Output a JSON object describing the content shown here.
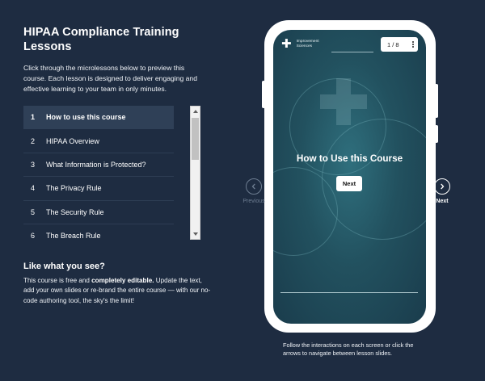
{
  "page": {
    "title": "HIPAA Compliance Training Lessons",
    "intro": "Click through the microlessons below to preview this course. Each lesson is designed to deliver engaging and effective learning to your team in only minutes."
  },
  "lessons": [
    {
      "num": "1",
      "label": "How to use this course",
      "active": true
    },
    {
      "num": "2",
      "label": "HIPAA Overview",
      "active": false
    },
    {
      "num": "3",
      "label": "What Information is Protected?",
      "active": false
    },
    {
      "num": "4",
      "label": "The Privacy Rule",
      "active": false
    },
    {
      "num": "5",
      "label": "The Security Rule",
      "active": false
    },
    {
      "num": "6",
      "label": "The Breach Rule",
      "active": false
    }
  ],
  "like": {
    "heading": "Like what you see?",
    "text_1": "This course is free and ",
    "bold": "completely editable.",
    "text_2": " Update the text, add your own slides or re-brand the entire course — with our no-code authoring tool, the sky's the limit!"
  },
  "phone": {
    "logo_line1": "Improvement",
    "logo_line2": "Sciences",
    "pager": "1 / 8",
    "slide_title": "How to Use this Course",
    "next_button": "Next"
  },
  "nav": {
    "previous": "Previous",
    "next": "Next"
  },
  "footer_note": "Follow the interactions on each screen or click the arrows to navigate between lesson slides.",
  "colors": {
    "background": "#1e2c41",
    "active_row": "#2f4057",
    "screen_teal": "#22515f"
  },
  "icons": {
    "logo": "plus-icon",
    "menu": "vertical-dots-icon",
    "prev": "chevron-left-icon",
    "next": "chevron-right-icon"
  }
}
